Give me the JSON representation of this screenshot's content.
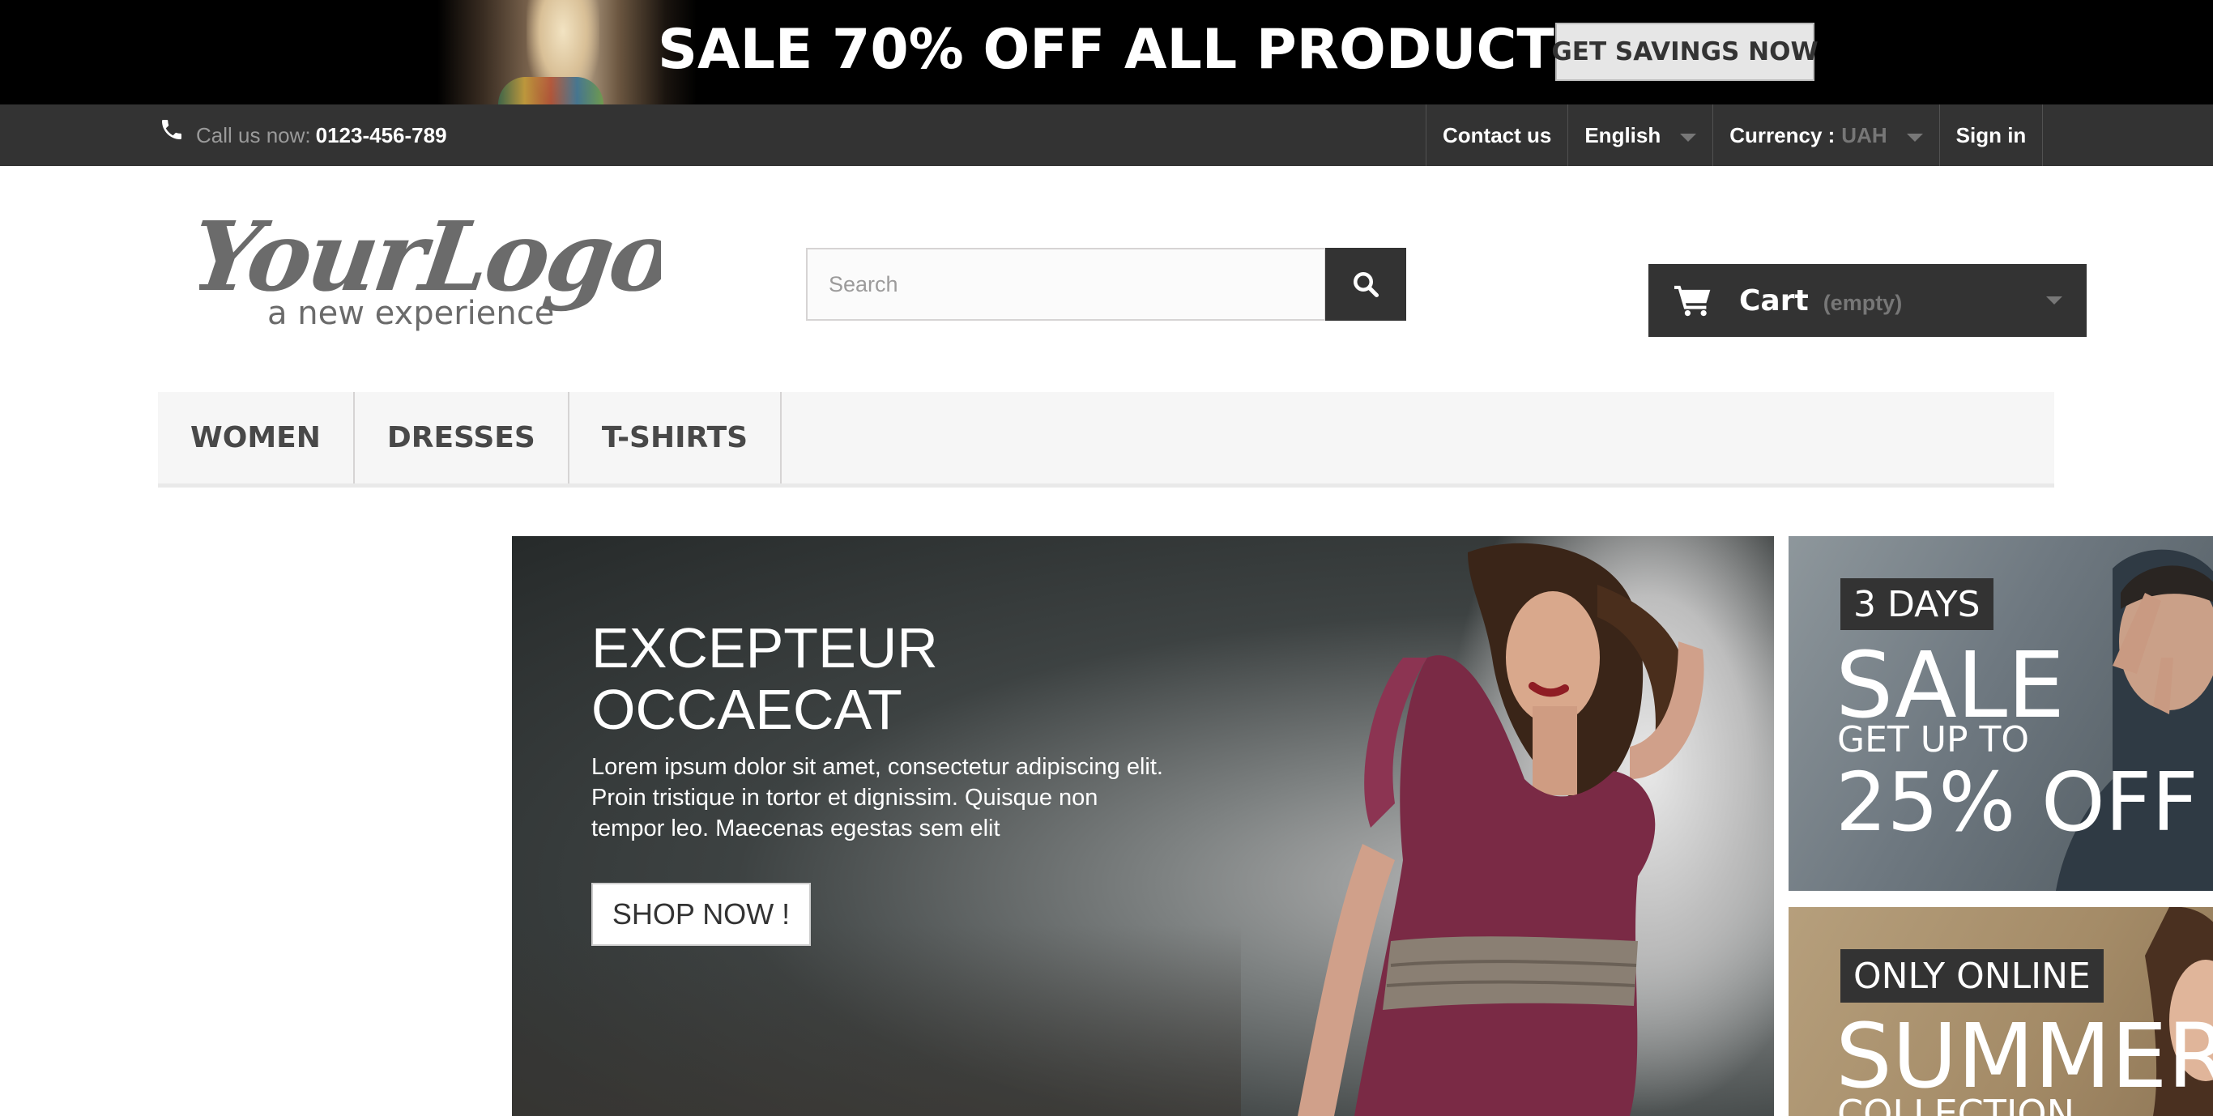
{
  "promo": {
    "title": "SALE 70% OFF ALL PRODUCTS",
    "cta": "GET SAVINGS NOW"
  },
  "topbar": {
    "call_label": "Call us now:",
    "phone": "0123-456-789",
    "contact": "Contact us",
    "language": "English",
    "currency_label": "Currency :",
    "currency_value": "UAH",
    "signin": "Sign in"
  },
  "header": {
    "logo_text": "YourLogo",
    "logo_tagline": "a new experience",
    "search_placeholder": "Search",
    "cart_label": "Cart",
    "cart_status": "(empty)"
  },
  "menu": {
    "items": [
      "WOMEN",
      "DRESSES",
      "T-SHIRTS"
    ]
  },
  "hero": {
    "title": "EXCEPTEUR\nOCCAECAT",
    "text": "Lorem ipsum dolor sit amet, consectetur adipiscing elit. Proin tristique in tortor et dignissim. Quisque non tempor leo. Maecenas egestas sem elit",
    "button": "SHOP NOW !"
  },
  "side_banners": {
    "first": {
      "tag": "3 DAYS",
      "headline": "SALE",
      "sub": "GET UP TO",
      "percent": "25% OFF"
    },
    "second": {
      "tag": "ONLY ONLINE",
      "headline": "SUMMER",
      "sub": "COLLECTION"
    }
  },
  "colors": {
    "dark": "#333333",
    "menu_bg": "#f6f6f6",
    "promo_bg": "#000000"
  }
}
